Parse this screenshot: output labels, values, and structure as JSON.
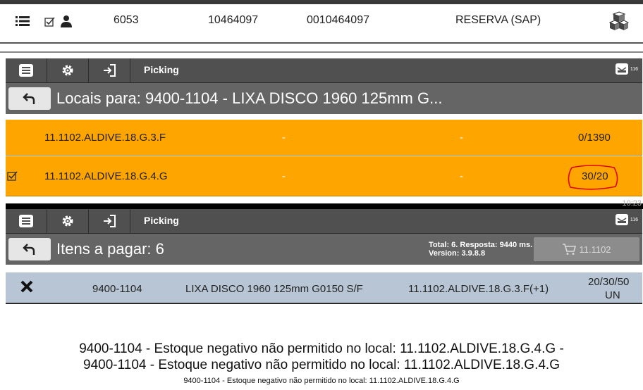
{
  "panel1": {
    "code": "6053",
    "number1": "10464097",
    "number2": "0010464097",
    "source": "RESERVA (SAP)"
  },
  "screen1": {
    "app_title": "Picking",
    "badge_count": "116",
    "header_title": "Locais para: 9400-1104 - LIXA DISCO 1960 125mm G...",
    "rows": [
      {
        "location": "11.1102.ALDIVE.18.G.3.F",
        "col2": "-",
        "col3": "-",
        "qty": "0/1390",
        "checked": false
      },
      {
        "location": "11.1102.ALDIVE.18.G.4.G",
        "col2": "-",
        "col3": "-",
        "qty": "30/20",
        "checked": true
      }
    ]
  },
  "screen2": {
    "clock": "10:23",
    "app_title": "Picking",
    "badge_count": "116",
    "header_title": "Itens a pagar: 6",
    "info_line1": "Total: 6. Resposta: 9440 ms.",
    "info_line2": "Version: 3.9.8.8",
    "cart_label": "11.1102",
    "item": {
      "code": "9400-1104",
      "description": "LIXA DISCO 1960 125mm G0150 S/F",
      "location": "11.1102.ALDIVE.18.G.3.F(+1)",
      "qty": "20/30/50",
      "unit": "UN"
    }
  },
  "messages": {
    "line1": "9400-1104 - Estoque negativo não permitido no local: 11.1102.ALDIVE.18.G.4.G -",
    "line2": "9400-1104 - Estoque negativo não permitido no local: 11.1102.ALDIVE.18.G.4.G",
    "line3": "9400-1104 - Estoque negativo não permitido no local: 11.1102.ALDIVE.18.G.4.G"
  },
  "colors": {
    "orange_row": "#ffa500",
    "dark_header": "#505050",
    "blue_row": "#b7c5d4",
    "highlight_circle": "#e00000"
  }
}
